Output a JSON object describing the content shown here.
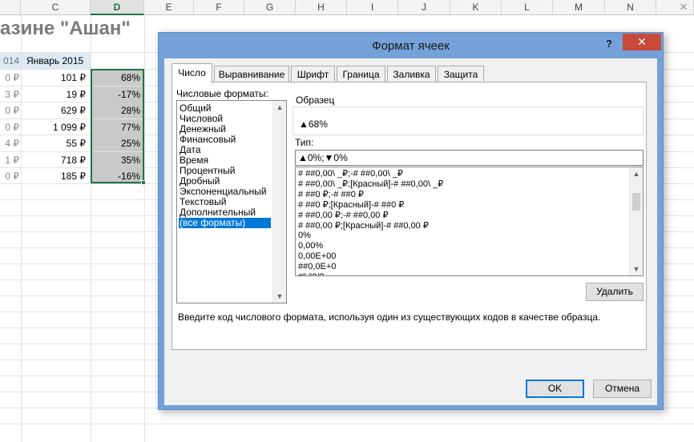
{
  "sheet": {
    "columns": [
      "C",
      "D",
      "E",
      "F",
      "G",
      "H",
      "I",
      "J",
      "K",
      "L",
      "M",
      "N"
    ],
    "selected_column": "D",
    "title": "азине \"Ашан\"",
    "header_prev_year": "014",
    "header_label": "Январь 2015",
    "rows": [
      {
        "prev": "0 ₽",
        "value": "101 ₽",
        "pct": "68%"
      },
      {
        "prev": "3 ₽",
        "value": "19 ₽",
        "pct": "-17%"
      },
      {
        "prev": "0 ₽",
        "value": "629 ₽",
        "pct": "28%"
      },
      {
        "prev": "0 ₽",
        "value": "1 099 ₽",
        "pct": "77%"
      },
      {
        "prev": "4 ₽",
        "value": "55 ₽",
        "pct": "25%"
      },
      {
        "prev": "1 ₽",
        "value": "718 ₽",
        "pct": "35%"
      },
      {
        "prev": "0 ₽",
        "value": "185 ₽",
        "pct": "-16%"
      }
    ],
    "close_glyph": "✕"
  },
  "dialog": {
    "title": "Формат ячеек",
    "help_glyph": "?",
    "close_glyph": "✕",
    "tabs": [
      "Число",
      "Выравнивание",
      "Шрифт",
      "Граница",
      "Заливка",
      "Защита"
    ],
    "active_tab": "Число",
    "categories_label": "Числовые форматы:",
    "categories": [
      "Общий",
      "Числовой",
      "Денежный",
      "Финансовый",
      "Дата",
      "Время",
      "Процентный",
      "Дробный",
      "Экспоненциальный",
      "Текстовый",
      "Дополнительный",
      "(все форматы)"
    ],
    "selected_category": "(все форматы)",
    "sample_label": "Образец",
    "sample_value": "▲68%",
    "type_label": "Тип:",
    "type_value": "▲0%;▼0%",
    "formats": [
      "# ##0,00\\ _₽;-# ##0,00\\ _₽",
      "# ##0,00\\ _₽;[Красный]-# ##0,00\\ _₽",
      "# ##0 ₽;-# ##0 ₽",
      "# ##0 ₽;[Красный]-# ##0 ₽",
      "# ##0,00 ₽;-# ##0,00 ₽",
      "# ##0,00 ₽;[Красный]-# ##0,00 ₽",
      "0%",
      "0,00%",
      "0,00E+00",
      "##0,0E+0",
      "#\" \"?/?"
    ],
    "delete_button": "Удалить",
    "hint": "Введите код числового формата, используя один из существующих кодов в качестве образца.",
    "ok_button": "OK",
    "cancel_button": "Отмена",
    "scroll_up": "▲",
    "scroll_down": "▼"
  }
}
